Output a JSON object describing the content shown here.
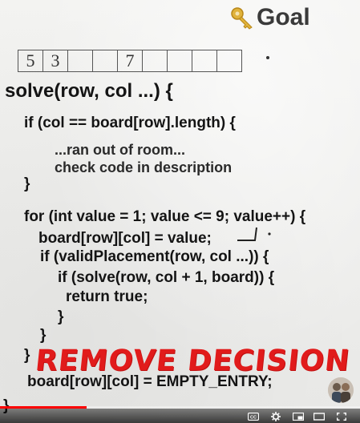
{
  "overlay": {
    "title": "Goal",
    "key_icon": "key-icon"
  },
  "cells": [
    "5",
    "3",
    "",
    "",
    "7",
    "",
    "",
    "",
    ""
  ],
  "code": {
    "l1": "solve(row, col  ...) {",
    "l2": "if (col == board[row].length) {",
    "l3": "...ran out of room...",
    "l4": "check code in description",
    "l5": "}",
    "l6": "for (int value = 1; value <= 9; value++) {",
    "l7": "board[row][col] = value;",
    "l8": "if (validPlacement(row, col ...)) {",
    "l9": "if (solve(row, col + 1, board)) {",
    "l10": "return true;",
    "l11": "}",
    "l12": "}",
    "l13": "}",
    "l14": "board[row][col] = EMPTY_ENTRY;",
    "l15": "}"
  },
  "annotation": {
    "text": "REMOVE DECISION",
    "color": "#e11b1b"
  },
  "player": {
    "progress": 0.24,
    "accent": "#ff0000",
    "controls": [
      "cc-icon",
      "gear-icon",
      "miniplayer-icon",
      "theater-icon",
      "fullscreen-icon"
    ]
  }
}
